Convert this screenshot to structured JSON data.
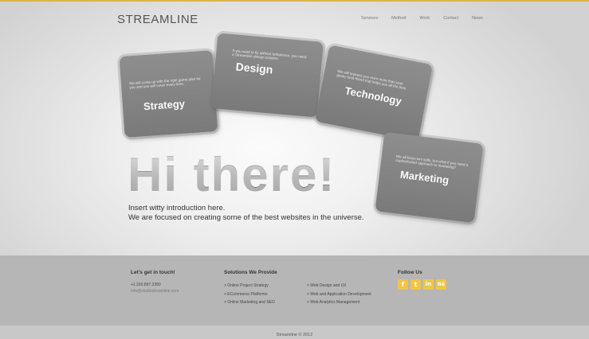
{
  "logo": "STREAMLINE",
  "nav": [
    "Services",
    "Method",
    "Work",
    "Contact",
    "News"
  ],
  "cards": {
    "strategy": {
      "desc": "We will come up with the right game plan for you and you will cover every time.",
      "title": "Strategy"
    },
    "design": {
      "desc": "If you want to fly without turbulence, you need a Streamline design solution.",
      "title": "Design"
    },
    "technology": {
      "desc": "We will impress you even more than your geeky best friend that helps you all the time.",
      "title": "Technology"
    },
    "marketing": {
      "desc": "We all know sex sells, but what if you need a sophisticated approach to marketing?",
      "title": "Marketing"
    }
  },
  "hero": {
    "headline": "Hi there!",
    "intro_line1": "Insert witty introduction here.",
    "intro_line2": "We are focused on creating some of the best websites in the universe."
  },
  "footer": {
    "contact_heading": "Let's get in touch!",
    "phone": "+1.310.897.3350",
    "email": "info@studiostreamline.com",
    "solutions_heading": "Solutions We Provide",
    "solutions_col1": [
      "> Online Project Strategy",
      "> ECommerce Platforms",
      "> Online Marketing and SEO"
    ],
    "solutions_col2": [
      "> Web Design and UX",
      "> Web and Application Development",
      "> Web Analytics Management"
    ],
    "follow_heading": "Follow Us",
    "socials": [
      {
        "icon": "facebook-icon",
        "glyph": "f"
      },
      {
        "icon": "twitter-icon",
        "glyph": "t"
      },
      {
        "icon": "linkedin-icon",
        "glyph": "in"
      },
      {
        "icon": "behance-icon",
        "glyph": "Bē"
      }
    ],
    "copyright": "Streamline © 2012"
  },
  "colors": {
    "accent": "#f0c542",
    "topline": "#d9b64a",
    "card": "#808080",
    "footer": "#b6b6b6"
  }
}
